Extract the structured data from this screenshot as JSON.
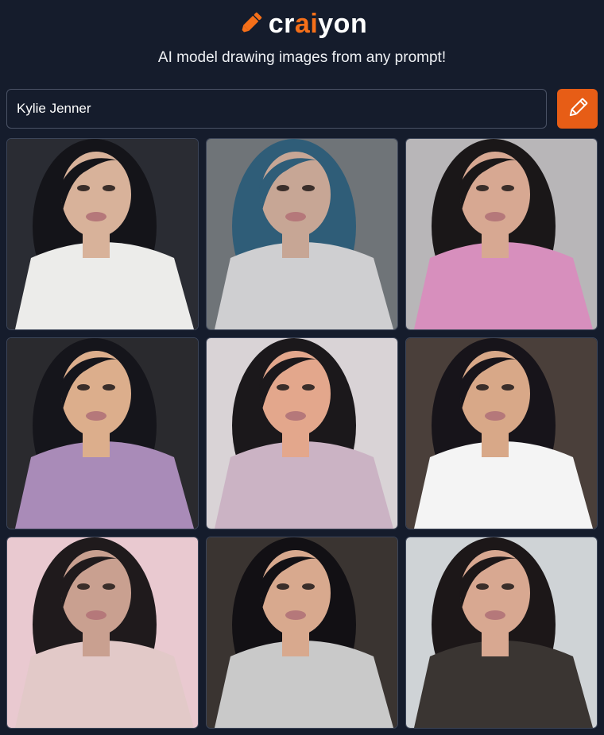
{
  "app": {
    "logo_prefix": "cr",
    "logo_accent": "ai",
    "logo_suffix": "yon",
    "tagline": "AI model drawing images from any prompt!",
    "accent_color": "#f56f19",
    "background_color": "#151c2c"
  },
  "search": {
    "value": "Kylie Jenner",
    "button_icon": "pencil-icon"
  },
  "results": {
    "count": 9,
    "images": [
      {
        "bg": "#2a2c33",
        "hair": "#141419",
        "skin": "#d8b29a",
        "shirt": "#ececea"
      },
      {
        "bg": "#6f7478",
        "hair": "#2f5d78",
        "skin": "#c7a695",
        "shirt": "#cfcfd1"
      },
      {
        "bg": "#b8b6b8",
        "hair": "#1a1718",
        "skin": "#d7a892",
        "shirt": "#d78fbd"
      },
      {
        "bg": "#2a2a2e",
        "hair": "#15151b",
        "skin": "#dcae8c",
        "shirt": "#a98bb8"
      },
      {
        "bg": "#d9d3d6",
        "hair": "#1b181b",
        "skin": "#e3a78c",
        "shirt": "#cbb3c4"
      },
      {
        "bg": "#4a3f3a",
        "hair": "#17141a",
        "skin": "#d8a888",
        "shirt": "#f4f4f4"
      },
      {
        "bg": "#e9c9d0",
        "hair": "#1f1a1c",
        "skin": "#c9a090",
        "shirt": "#e2c9c8"
      },
      {
        "bg": "#3a3431",
        "hair": "#121014",
        "skin": "#d8a98e",
        "shirt": "#c9c9c9"
      },
      {
        "bg": "#cfd3d6",
        "hair": "#1c1718",
        "skin": "#d8a891",
        "shirt": "#3a3532"
      }
    ]
  }
}
